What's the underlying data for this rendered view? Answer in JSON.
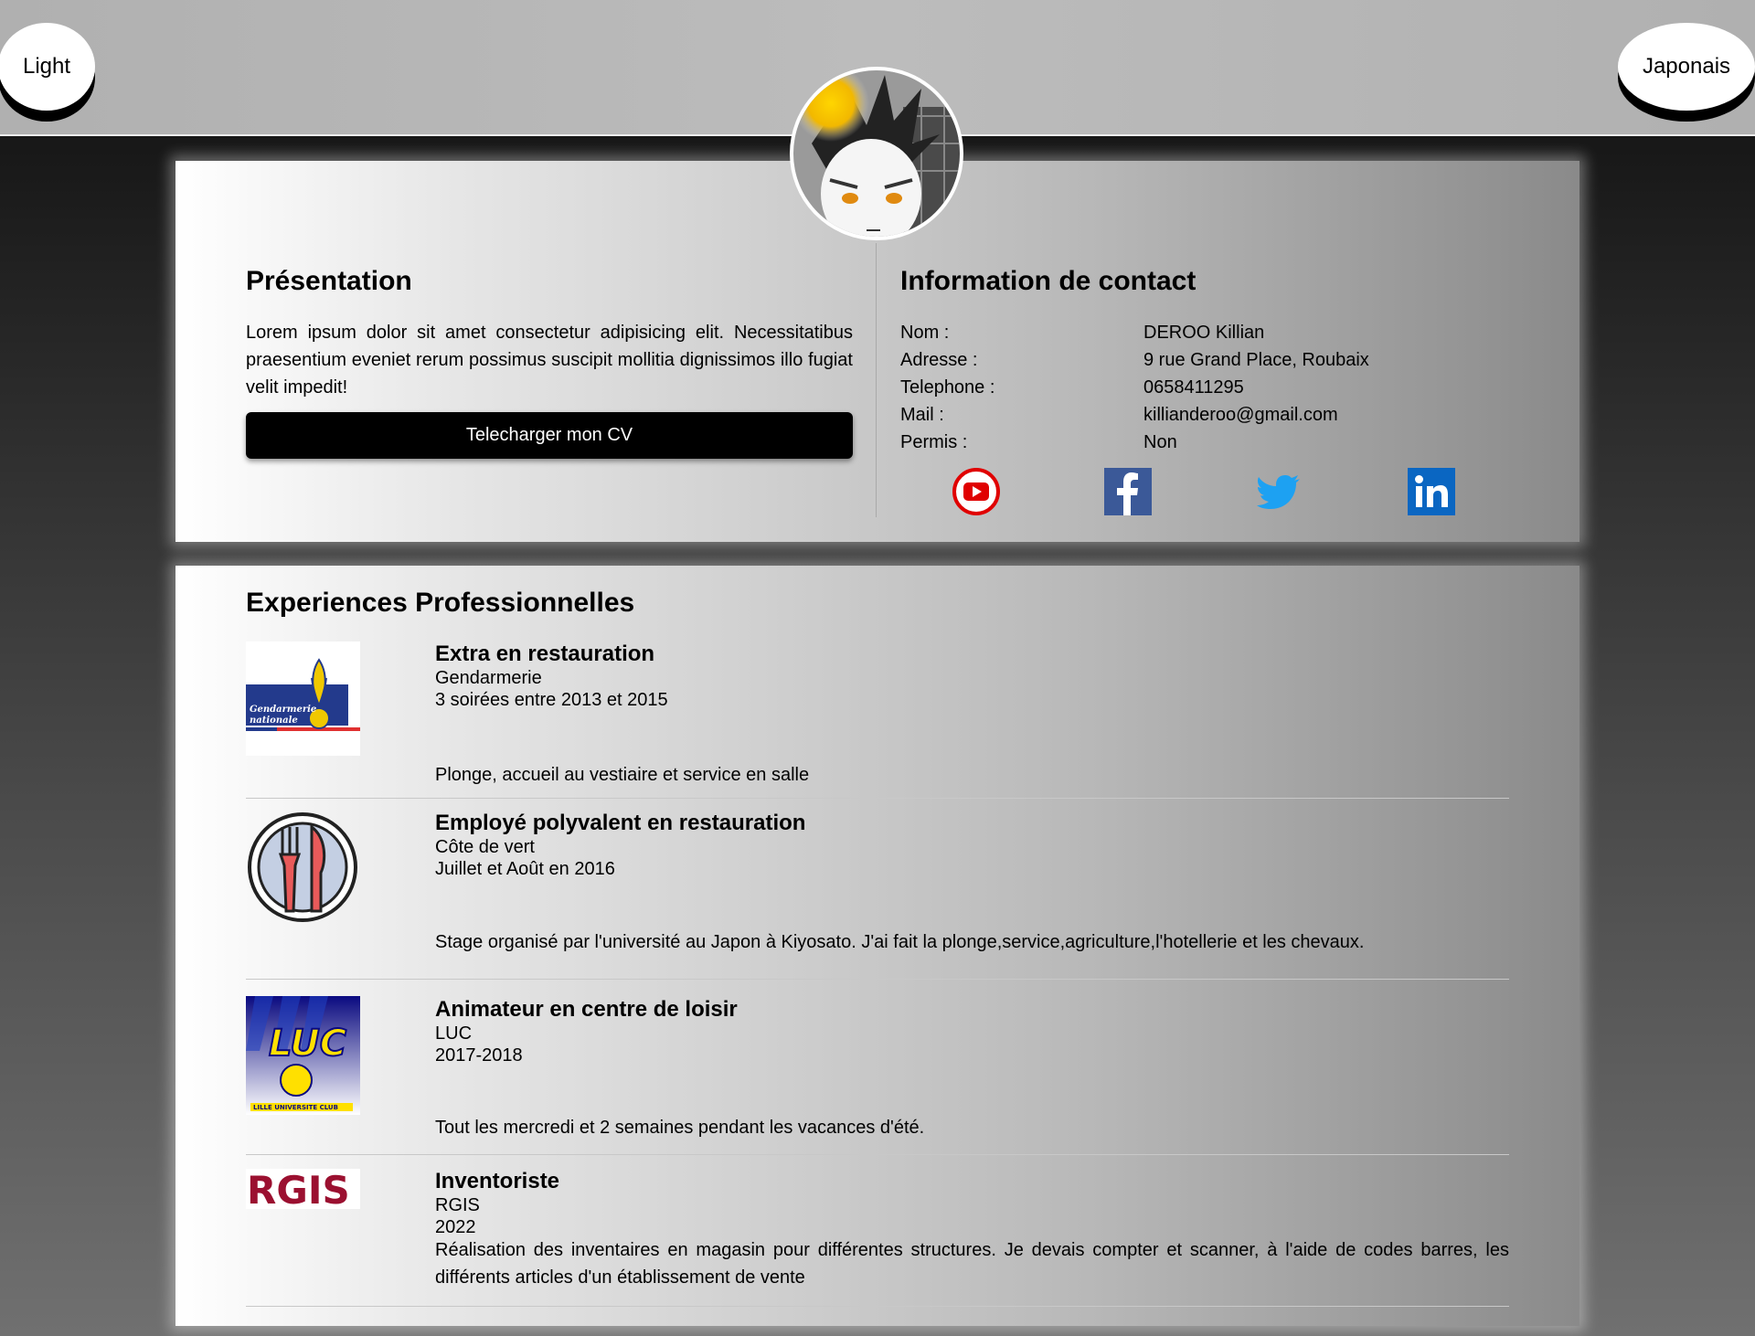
{
  "header": {
    "theme_toggle": "Light",
    "language_toggle": "Japonais"
  },
  "presentation": {
    "title": "Présentation",
    "text": "Lorem ipsum dolor sit amet consectetur adipisicing elit. Necessitatibus praesentium eveniet rerum possimus suscipit mollitia dignissimos illo fugiat velit impedit!",
    "cv_button": "Telecharger mon CV"
  },
  "contact": {
    "title": "Information de contact",
    "rows": [
      {
        "label": "Nom :",
        "value": "DEROO Killian"
      },
      {
        "label": "Adresse :",
        "value": "9 rue Grand Place, Roubaix"
      },
      {
        "label": "Telephone :",
        "value": "0658411295"
      },
      {
        "label": "Mail :",
        "value": "killianderoo@gmail.com"
      },
      {
        "label": "Permis :",
        "value": "Non"
      }
    ],
    "socials": [
      "youtube-icon",
      "facebook-icon",
      "twitter-icon",
      "linkedin-icon"
    ]
  },
  "experiences": {
    "title": "Experiences Professionnelles",
    "items": [
      {
        "role": "Extra en restauration",
        "company": "Gendarmerie",
        "period": "3 soirées entre 2013 et 2015",
        "description": "Plonge, accueil au vestiaire et service en salle",
        "logo_lines": [
          "Gendarmerie",
          "nationale"
        ]
      },
      {
        "role": "Employé polyvalent en restauration",
        "company": "Côte de vert",
        "period": "Juillet et Août en 2016",
        "description": "Stage organisé par l'université au Japon à Kiyosato. J'ai fait la plonge,service,agriculture,l'hotellerie et les chevaux."
      },
      {
        "role": "Animateur en centre de loisir",
        "company": "LUC",
        "period": "2017-2018",
        "description": "Tout les mercredi et 2 semaines pendant les vacances d'été.",
        "logo_text": "LUC",
        "logo_sub": "LILLE UNIVERSITE CLUB"
      },
      {
        "role": "Inventoriste",
        "company": "RGIS",
        "period": "2022",
        "description": "Réalisation des inventaires en magasin pour différentes structures. Je devais compter et scanner, à l'aide de codes barres, les différents articles d'un établissement de vente",
        "logo_text": "RGIS"
      }
    ]
  }
}
